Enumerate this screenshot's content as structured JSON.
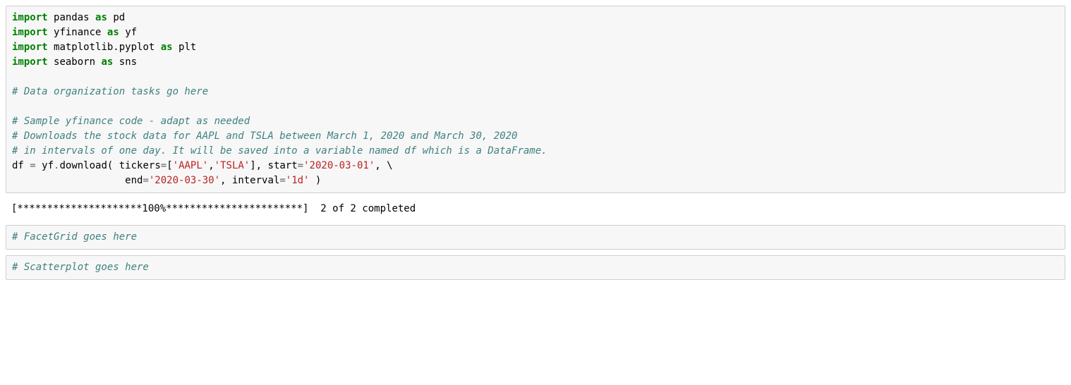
{
  "cell1": {
    "line1": {
      "kw1": "import",
      "nn1": "pandas",
      "kw2": "as",
      "nn2": "pd"
    },
    "line2": {
      "kw1": "import",
      "nn1": "yfinance",
      "kw2": "as",
      "nn2": "yf"
    },
    "line3": {
      "kw1": "import",
      "nn1": "matplotlib.pyplot",
      "kw2": "as",
      "nn2": "plt"
    },
    "line4": {
      "kw1": "import",
      "nn1": "seaborn",
      "kw2": "as",
      "nn2": "sns"
    },
    "blank1": "",
    "line5": {
      "cm": "# Data organization tasks go here"
    },
    "blank2": "",
    "line6": {
      "cm": "# Sample yfinance code - adapt as needed"
    },
    "line7": {
      "cm": "# Downloads the stock data for AAPL and TSLA between March 1, 2020 and March 30, 2020"
    },
    "line8": {
      "cm": "# in intervals of one day. It will be saved into a variable named df which is a DataFrame."
    },
    "line9": {
      "p1": "df ",
      "op1": "=",
      "p2": " yf",
      "op2": ".",
      "p3": "download( tickers",
      "op3": "=",
      "p4": "[",
      "s1": "'AAPL'",
      "p5": ",",
      "s2": "'TSLA'",
      "p6": "], start",
      "op4": "=",
      "s3": "'2020-03-01'",
      "p7": ", ",
      "bs": "\\"
    },
    "line10": {
      "indent": "                   end",
      "op1": "=",
      "s1": "'2020-03-30'",
      "p1": ", interval",
      "op2": "=",
      "s2": "'1d'",
      "p2": " )"
    }
  },
  "output1": "[*********************100%***********************]  2 of 2 completed",
  "cell2": {
    "cm": "# FacetGrid goes here"
  },
  "cell3": {
    "cm": "# Scatterplot goes here"
  }
}
